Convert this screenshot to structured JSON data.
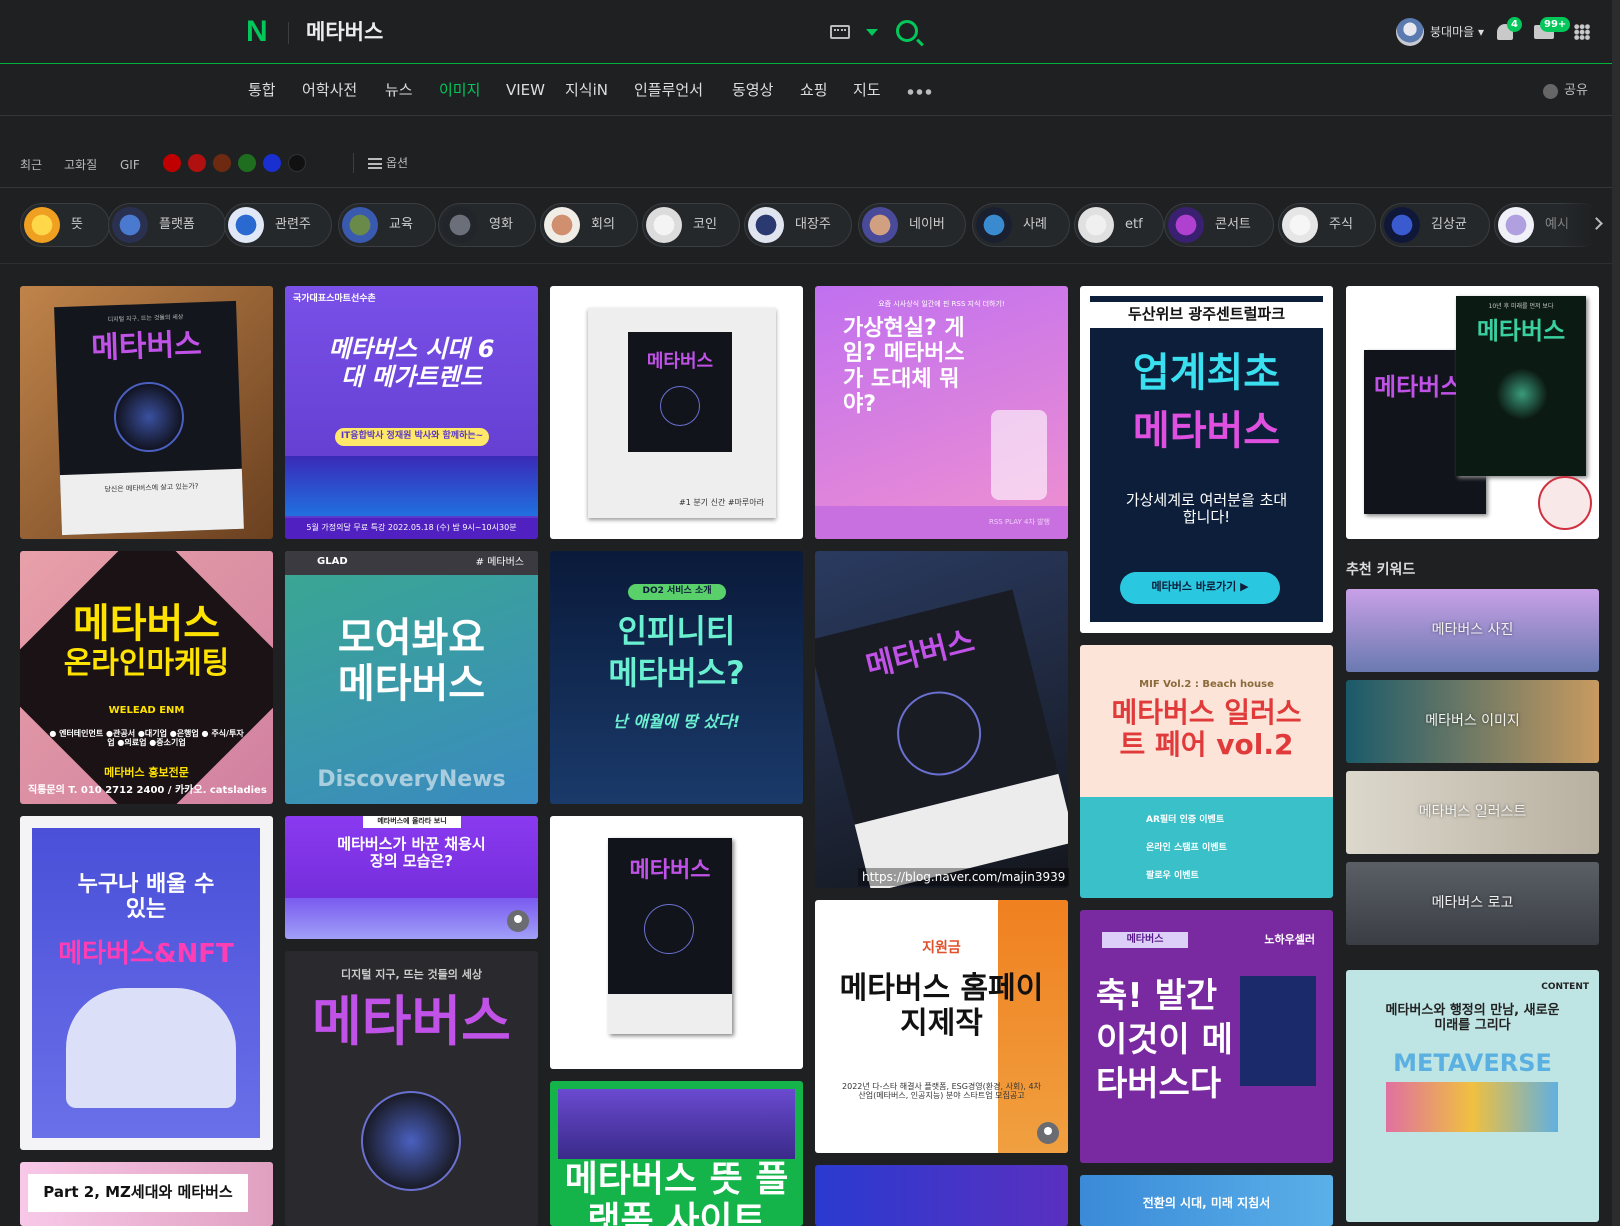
{
  "header": {
    "logo": "N",
    "query": "메타버스",
    "username": "붕대마을",
    "notif_count": "4",
    "mail_count": "99+"
  },
  "nav": {
    "tabs": [
      "통합",
      "어학사전",
      "뉴스",
      "이미지",
      "VIEW",
      "지식iN",
      "인플루언서",
      "동영상",
      "쇼핑",
      "지도"
    ],
    "active": "이미지",
    "share_label": "공유"
  },
  "filters": {
    "items": [
      "최근",
      "고화질",
      "GIF"
    ],
    "colors": [
      "#c00000",
      "#b01010",
      "#6e2a10",
      "#1f6e1f",
      "#1a2fd0",
      "#111111"
    ],
    "option_label": "옵션"
  },
  "chips": [
    "뜻",
    "플랫폼",
    "관련주",
    "교육",
    "영화",
    "회의",
    "코인",
    "대장주",
    "네이버",
    "사례",
    "etf",
    "콘서트",
    "주식",
    "김상균",
    "예시"
  ],
  "images": {
    "c1_1": {
      "top": "디지털 지구, 뜨는 것들의 세상",
      "title": "메타버스",
      "sub": "당신은 메타버스에 살고 있는가?"
    },
    "c2_1": {
      "tag": "국가대표스마트선수촌",
      "title": "메타버스 시대 6대 메가트렌드",
      "sub": "IT융합박사 정재원 박사와 함께하는~",
      "foot": "5월 가정의달 무료 특강  2022.05.18 (수) 밤 9시~10시30분"
    },
    "c3_1": {
      "title": "메타버스",
      "caption": "#1 분기 신간 #마루아라"
    },
    "c4_1": {
      "top": "요즘 시사상식 일간에 핀 RSS 지식 더하기!",
      "title": "가상현실? 게임? 메타버스가 도대체 뭐야?",
      "foot": "RSS PLAY 4차 발행"
    },
    "c5_1": {
      "brand": "두산위브 광주센트럴파크",
      "title1": "업계최초",
      "title2": "메타버스",
      "sub": "가상세계로 여러분을 초대합니다!",
      "button": "메타버스 바로가기 ▶"
    },
    "c6_1": {
      "title": "메타버스",
      "sub": "10년 후 미래를 먼저 보다"
    },
    "c1_2": {
      "title1": "메타버스",
      "title2": "온라인마케팅",
      "brand": "WELEAD ENM",
      "list": "● 엔터테인먼트 ●관공서 ●대기업 ●은행업 ● 주식/투자업 ●의료업 ●중소기업",
      "sub": "메타버스 홍보전문",
      "foot": "직통문의  T. 010 2712 2400 / 카카오. catsladies"
    },
    "c2_2": {
      "brand": "GLAD",
      "tag": "# 메타버스",
      "title": "모여봐요 메타버스",
      "foot": "DiscoveryNews"
    },
    "c3_2": {
      "tag": "DO2 서비스 소개",
      "title1": "인피니티",
      "title2": "메타버스?",
      "sub": "난 애월에 땅 샀다!"
    },
    "c4_2": {
      "url": "https://blog.naver.com/majin3939"
    },
    "c5_2": {
      "tag": "MIF Vol.2 : Beach house",
      "title": "메타버스 일러스트 페어 vol.2",
      "items": [
        "AR필터 인증 이벤트",
        "온라인 스탬프 이벤트",
        "팔로우 이벤트"
      ]
    },
    "c1_3": {
      "title1": "누구나 배울 수 있는",
      "title2": "메타버스&NFT"
    },
    "c2_3": {
      "tag": "메타버스에 올라타 보니",
      "title": "메타버스가 바꾼 채용시장의 모습은?"
    },
    "c2_4": {
      "top": "디지털 지구, 뜨는 것들의 세상",
      "title": "메타버스"
    },
    "c3_3": {
      "title": "메타버스"
    },
    "c3_4": {
      "title": "메타버스 뜻 플랫폼 사이트"
    },
    "c4_3": {
      "tag": "지원금",
      "title": "메타버스 홈페이지제작",
      "sub": "2022년 다-스타 해결사 플랫폼, ESG경영(환경, 사회), 4차산업(메타버스, 인공지능) 분야 스타트업 모집공고"
    },
    "c5_3": {
      "tag": "메타버스",
      "brand": "노하우셀러",
      "title": "축! 발간 이것이 메타버스다"
    },
    "c1_4": {
      "title": "Part 2, MZ세대와 메타버스"
    },
    "c5_4": {
      "title": "전환의 시대, 미래 지침서"
    },
    "c6_3": {
      "tag": "CONTENT",
      "title": "메타버스와 행정의 만남, 새로운 미래를 그리다",
      "big": "METAVERSE"
    }
  },
  "recommend": {
    "title": "추천 키워드",
    "items": [
      "메타버스 사진",
      "메타버스 이미지",
      "메타버스 일러스트",
      "메타버스 로고"
    ]
  }
}
